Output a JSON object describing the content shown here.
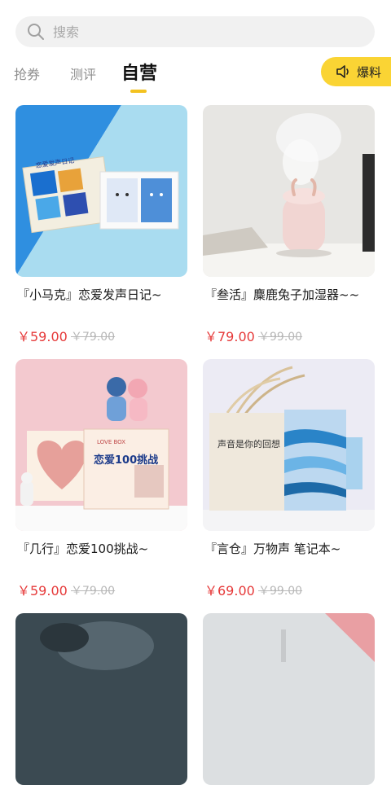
{
  "search": {
    "placeholder": "搜索"
  },
  "tabs": [
    {
      "label": "抢券"
    },
    {
      "label": "测评"
    },
    {
      "label": "自营"
    }
  ],
  "baoliao_label": "爆料",
  "products": [
    {
      "title": "『小马克』恋爱发声日记~",
      "price": "￥59.00",
      "original_price": "￥79.00",
      "image_caption": "恋爱发声日记"
    },
    {
      "title": "『叁活』麋鹿兔子加湿器~~",
      "price": "￥79.00",
      "original_price": "￥99.00"
    },
    {
      "title": "『几行』恋爱100挑战~",
      "price": "￥59.00",
      "original_price": "￥79.00",
      "image_caption": "恋爱100挑战",
      "image_badge": "LOVE BOX"
    },
    {
      "title": "『言仓』万物声  笔记本~",
      "price": "￥69.00",
      "original_price": "￥99.00",
      "image_caption": "声音是你的回想"
    },
    {
      "title": "",
      "price": "",
      "original_price": ""
    },
    {
      "title": "",
      "price": "",
      "original_price": ""
    }
  ],
  "colors": {
    "accent": "#fad434",
    "price": "#e63a3a"
  }
}
